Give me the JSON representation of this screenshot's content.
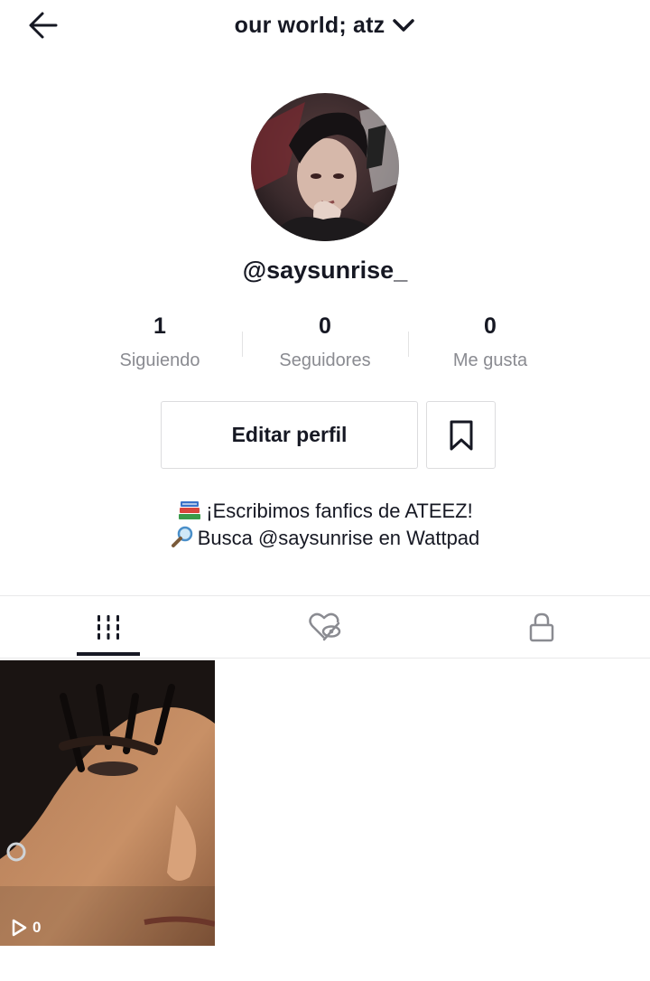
{
  "header": {
    "title": "our world; atz"
  },
  "profile": {
    "username": "@saysunrise_"
  },
  "stats": [
    {
      "value": "1",
      "label": "Siguiendo"
    },
    {
      "value": "0",
      "label": "Seguidores"
    },
    {
      "value": "0",
      "label": "Me gusta"
    }
  ],
  "actions": {
    "edit_label": "Editar perfil"
  },
  "bio": {
    "line1": "¡Escribimos fanfics de ATEEZ!",
    "line1_icon": "books-emoji",
    "line2": "Busca @saysunrise en Wattpad",
    "line2_icon": "magnifying-glass-emoji"
  },
  "tabs": [
    {
      "icon": "grid-icon",
      "active": true
    },
    {
      "icon": "hidden-liked-icon",
      "active": false
    },
    {
      "icon": "lock-icon",
      "active": false
    }
  ],
  "videos": [
    {
      "views": "0"
    }
  ],
  "colors": {
    "text": "#161823",
    "secondary": "#8a8b91",
    "border": "#dcdcde"
  }
}
